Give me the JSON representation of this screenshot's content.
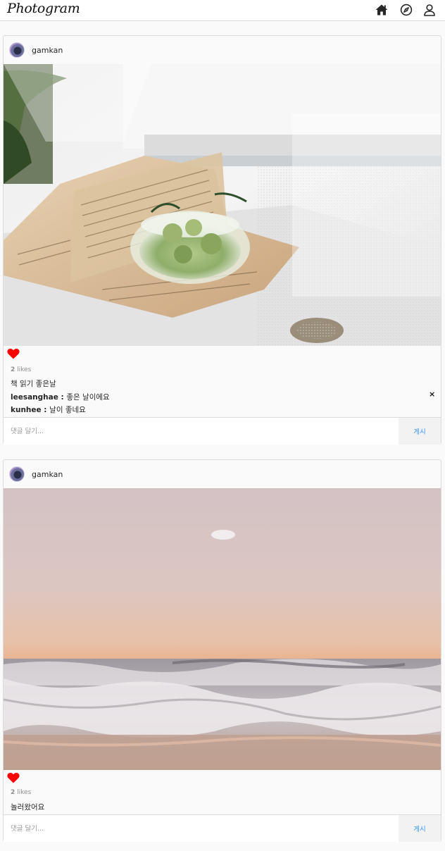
{
  "app": {
    "logo": "Photogram",
    "nav": [
      {
        "icon": "home-icon"
      },
      {
        "icon": "compass-icon"
      },
      {
        "icon": "user-icon"
      }
    ]
  },
  "posts": [
    {
      "username": "gamkan",
      "image_description_icon": "photo-book-glass-bowl",
      "liked": true,
      "likes_count": "2",
      "likes_label": "likes",
      "caption": "책 읽기 좋은날",
      "comments": [
        {
          "user": "leesanghae",
          "separator": " : ",
          "text": "좋은 날이에요"
        },
        {
          "user": "kunhee",
          "separator": " : ",
          "text": "날이 좋네요"
        }
      ],
      "delete_label": "×",
      "comment_placeholder": "댓글 달기...",
      "post_button": "게시"
    },
    {
      "username": "gamkan",
      "image_description_icon": "photo-sunset-sea",
      "liked": true,
      "likes_count": "2",
      "likes_label": "likes",
      "caption": "놀러왔어요",
      "comments": [],
      "comment_placeholder": "댓글 달기...",
      "post_button": "게시"
    }
  ],
  "colors": {
    "heart": "#ff0000",
    "post_button": "#3897f0",
    "border": "#dbdbdb"
  }
}
